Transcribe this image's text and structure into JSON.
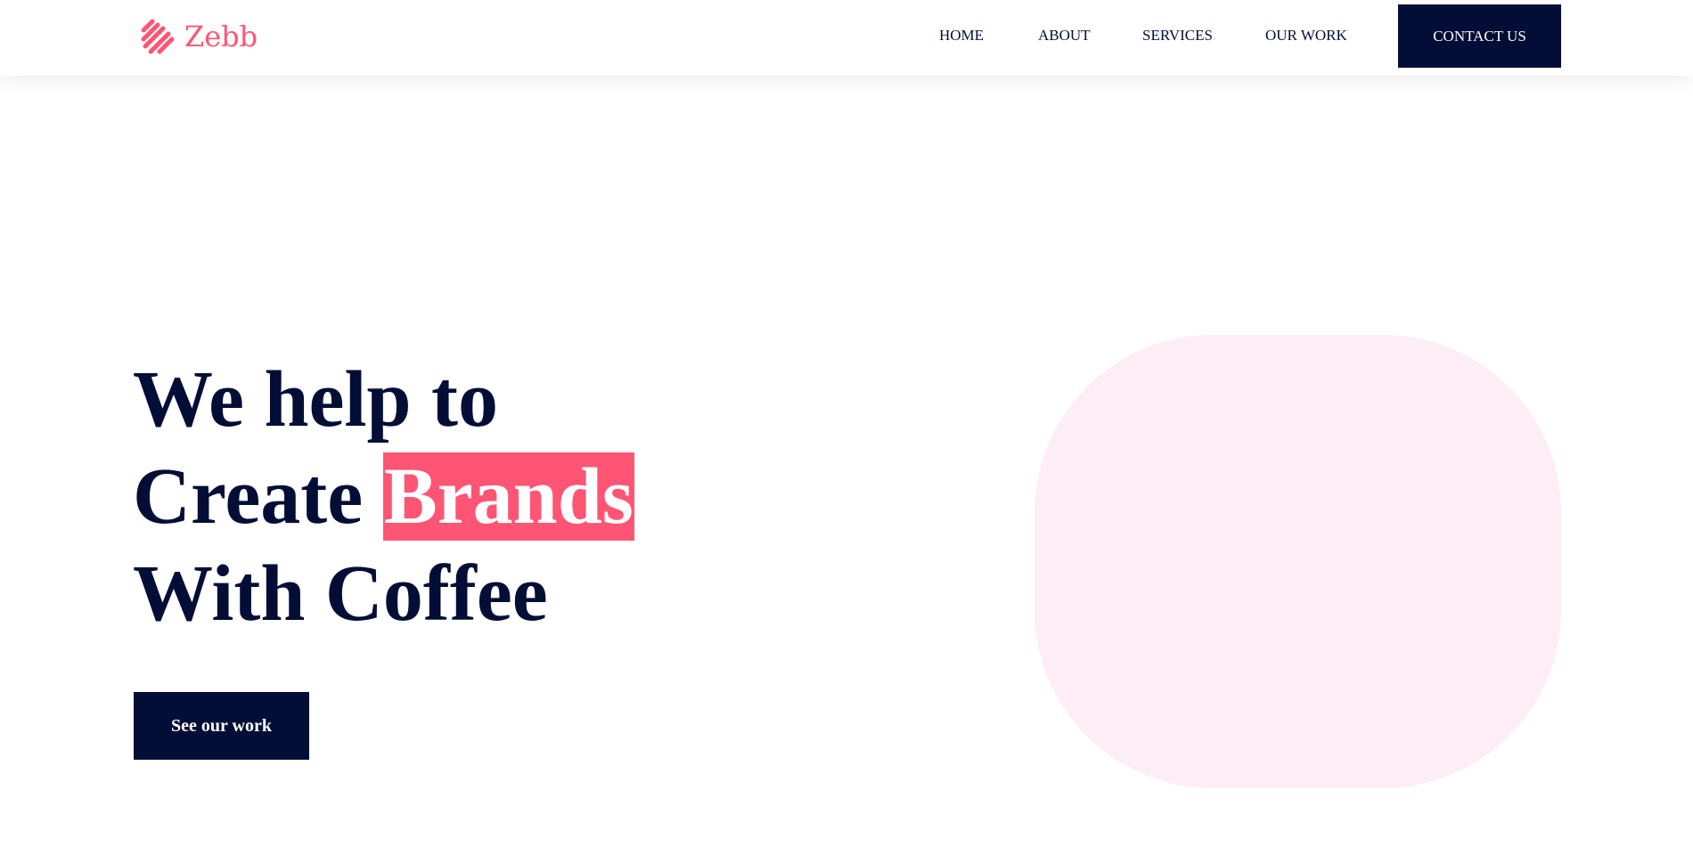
{
  "brand": {
    "name": "Zebb",
    "color": "#ff5574"
  },
  "nav": {
    "items": [
      {
        "label": "HOME"
      },
      {
        "label": "ABOUT"
      },
      {
        "label": "SERVICES"
      },
      {
        "label": "OUR WORK"
      }
    ],
    "contact_label": "CONTACT US"
  },
  "hero": {
    "line1": "We help to",
    "line2_prefix": "Create ",
    "highlight": "Brands",
    "line3": "With Coffee",
    "cta_label": "See our work"
  },
  "colors": {
    "navy": "#030e37",
    "accent": "#ff5574",
    "blob": "#fdedf4"
  }
}
